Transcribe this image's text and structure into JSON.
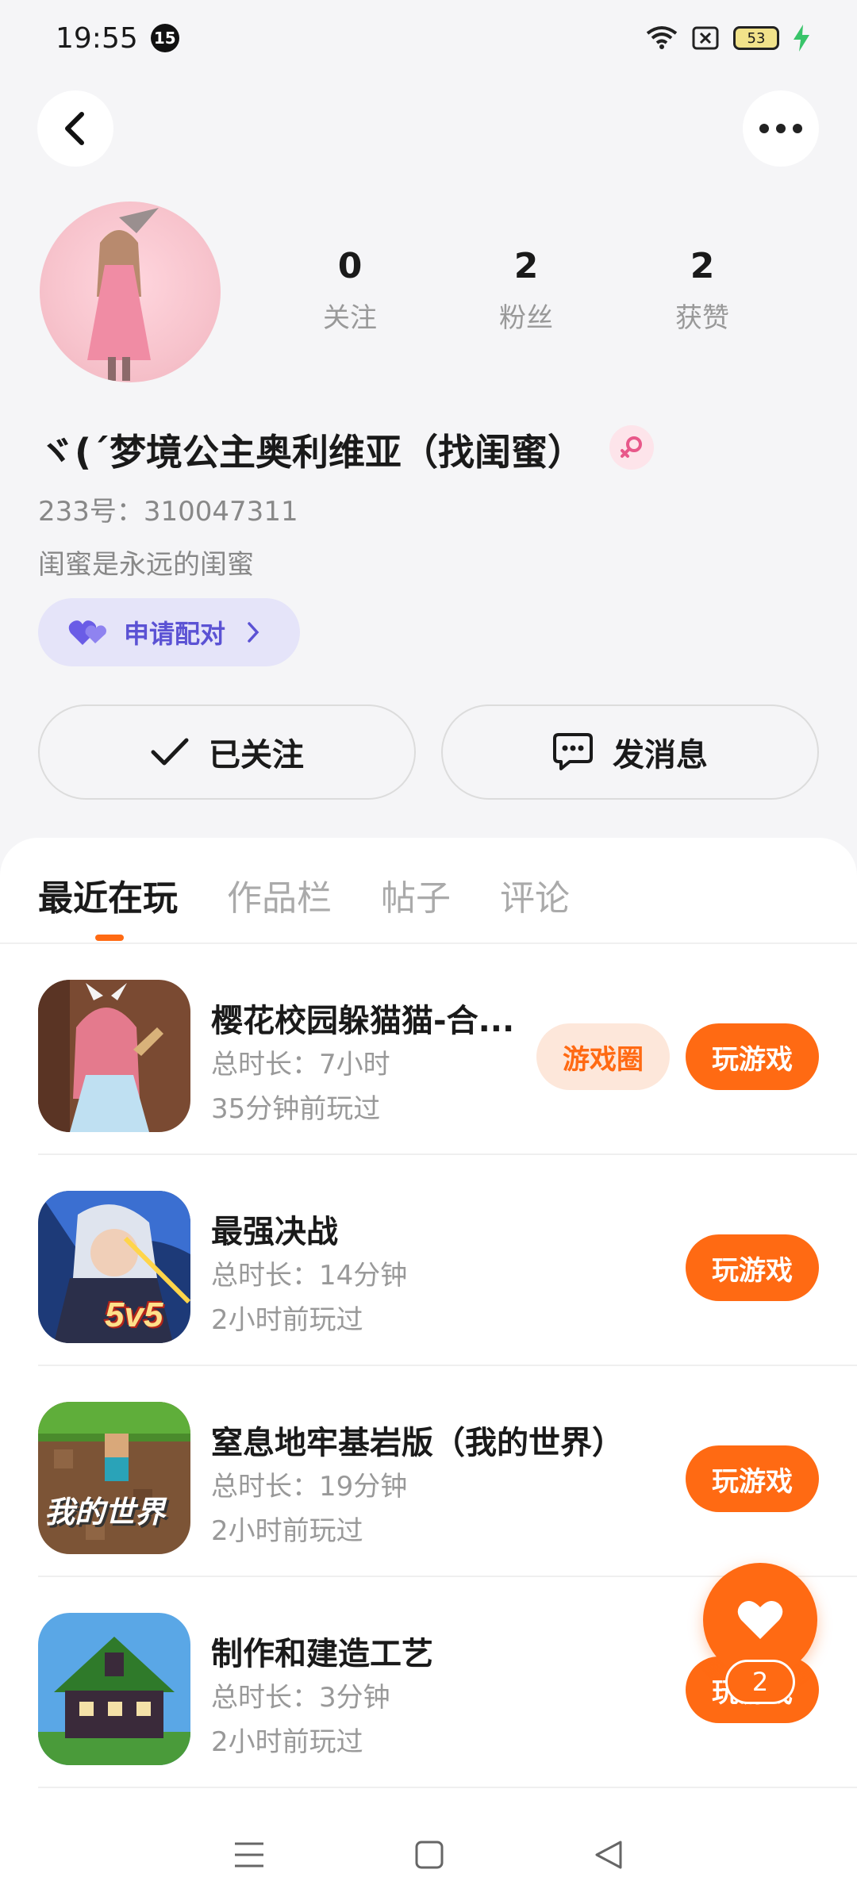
{
  "status_bar": {
    "time": "19:55",
    "notification_count": "15",
    "battery": "53"
  },
  "profile": {
    "stats": [
      {
        "value": "0",
        "label": "关注"
      },
      {
        "value": "2",
        "label": "粉丝"
      },
      {
        "value": "2",
        "label": "获赞"
      }
    ],
    "nickname": "ヾ(´梦境公主奥利维亚（找闺蜜）",
    "uid": "233号：310047311",
    "bio": "闺蜜是永远的闺蜜",
    "pair_label": "申请配对",
    "follow_label": "已关注",
    "message_label": "发消息"
  },
  "tabs": [
    "最近在玩",
    "作品栏",
    "帖子",
    "评论"
  ],
  "games": [
    {
      "name": "樱花校园躲猫猫-合...",
      "duration": "总时长：7小时",
      "last_played": "35分钟前玩过",
      "circle_label": "游戏圈",
      "play_label": "玩游戏",
      "icon": "anime-girl-icon"
    },
    {
      "name": "最强决战",
      "duration": "总时长：14分钟",
      "last_played": "2小时前玩过",
      "play_label": "玩游戏",
      "icon": "5v5-hero-icon",
      "icon_text": "5v5"
    },
    {
      "name": "窒息地牢基岩版（我的世界）",
      "duration": "总时长：19分钟",
      "last_played": "2小时前玩过",
      "play_label": "玩游戏",
      "icon": "minecraft-icon",
      "icon_text": "我的世界"
    },
    {
      "name": "制作和建造工艺",
      "duration": "总时长：3分钟",
      "last_played": "2小时前玩过",
      "play_label": "玩游戏",
      "icon": "voxel-house-icon"
    }
  ],
  "fab": {
    "count": "2"
  },
  "colors": {
    "accent": "#ff6a13",
    "pair": "#5b52d4",
    "pair_bg": "#e5e4f9",
    "circle_bg": "#fde7da"
  }
}
